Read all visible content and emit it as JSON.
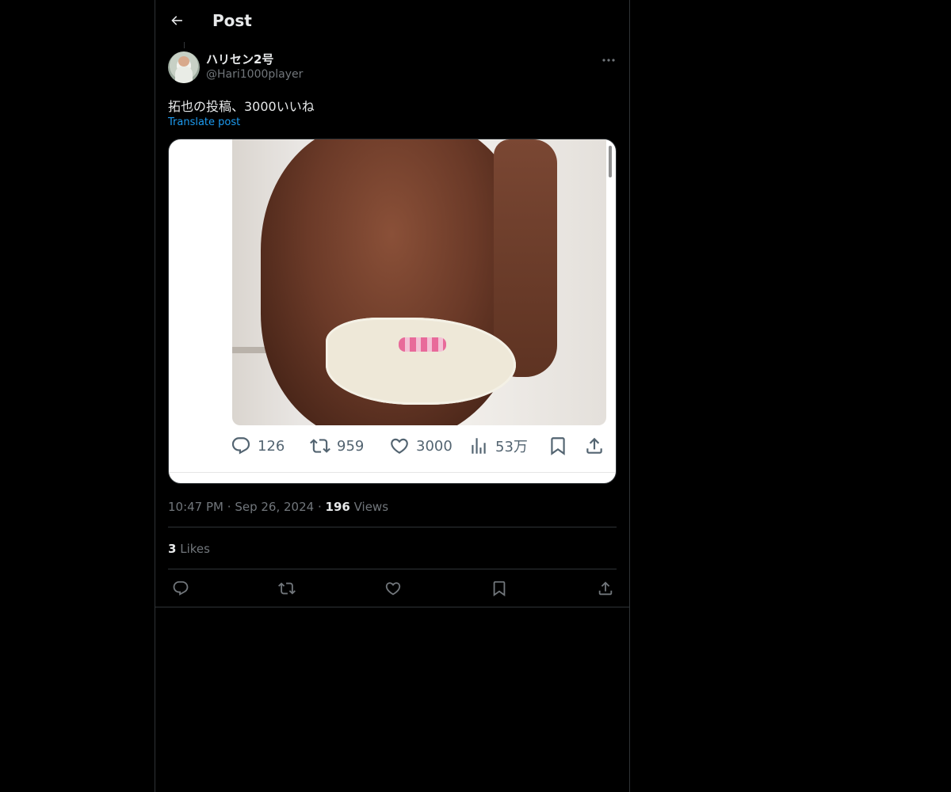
{
  "header": {
    "title": "Post",
    "back_icon": "arrow-left-icon"
  },
  "author": {
    "display_name": "ハリセン2号",
    "handle": "@Hari1000player",
    "more_icon": "more-horizontal-icon"
  },
  "post": {
    "text": "拓也の投稿、3000いいね",
    "translate_label": "Translate post"
  },
  "media": {
    "embedded_stats": {
      "replies": "126",
      "reposts": "959",
      "likes": "3000",
      "views": "53万"
    }
  },
  "meta": {
    "time": "10:47 PM",
    "date": "Sep 26, 2024",
    "separator": "·",
    "views_count": "196",
    "views_label": "Views"
  },
  "engagement": {
    "likes_count": "3",
    "likes_label": "Likes"
  },
  "actions": [
    "reply-icon",
    "repost-icon",
    "like-icon",
    "bookmark-icon",
    "share-icon"
  ],
  "colors": {
    "background": "#000000",
    "text": "#e7e9ea",
    "muted": "#71767b",
    "accent": "#1d9bf0",
    "border": "#2f3336"
  }
}
